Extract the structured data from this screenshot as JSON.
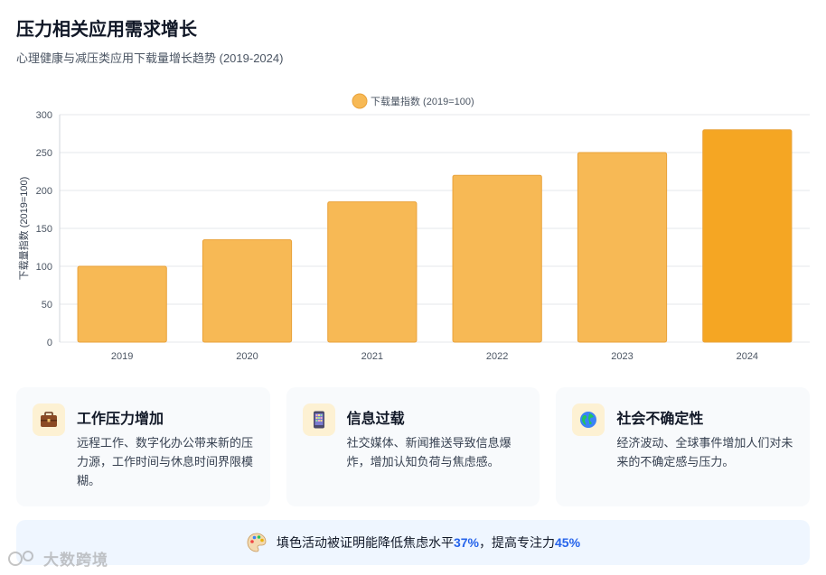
{
  "header": {
    "title": "压力相关应用需求增长",
    "subtitle": "心理健康与减压类应用下载量增长趋势 (2019-2024)"
  },
  "chart_data": {
    "type": "bar",
    "categories": [
      "2019",
      "2020",
      "2021",
      "2022",
      "2023",
      "2024"
    ],
    "series": [
      {
        "name": "下载量指数 (2019=100)",
        "values": [
          100,
          135,
          185,
          220,
          250,
          280
        ]
      }
    ],
    "ylabel": "下载量指数 (2019=100)",
    "xlabel": "",
    "ylim": [
      0,
      300
    ],
    "yticks": [
      "0",
      "50",
      "100",
      "150",
      "200",
      "250",
      "300"
    ],
    "grid": true,
    "legend": "top-center",
    "bar_color": "#f7b955",
    "highlight_color": "#f5a623",
    "highlight_index": 5
  },
  "cards": [
    {
      "icon": "briefcase-icon",
      "title": "工作压力增加",
      "text": "远程工作、数字化办公带来新的压力源，工作时间与休息时间界限模糊。"
    },
    {
      "icon": "phone-icon",
      "title": "信息过载",
      "text": "社交媒体、新闻推送导致信息爆炸，增加认知负荷与焦虑感。"
    },
    {
      "icon": "globe-icon",
      "title": "社会不确定性",
      "text": "经济波动、全球事件增加人们对未来的不确定感与压力。"
    }
  ],
  "banner": {
    "icon": "palette-icon",
    "text_before": "填色活动被证明能降低焦虑水平",
    "anxiety_pct": "37%",
    "text_middle": "，提高专注力",
    "focus_pct": "45%"
  },
  "watermark": {
    "text": "大数跨境"
  }
}
